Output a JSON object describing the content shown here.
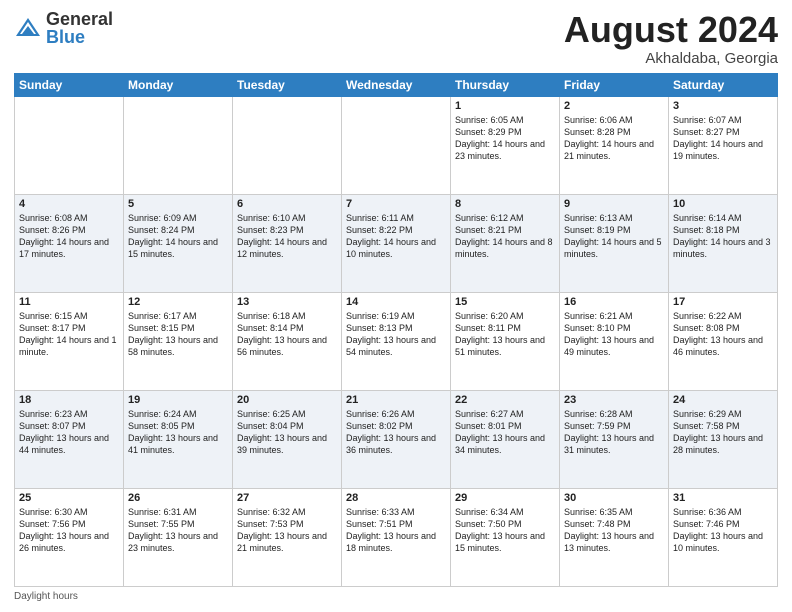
{
  "header": {
    "logo_general": "General",
    "logo_blue": "Blue",
    "month_year": "August 2024",
    "location": "Akhaldaba, Georgia"
  },
  "footer": {
    "daylight_label": "Daylight hours"
  },
  "days_of_week": [
    "Sunday",
    "Monday",
    "Tuesday",
    "Wednesday",
    "Thursday",
    "Friday",
    "Saturday"
  ],
  "weeks": [
    {
      "days": [
        {
          "num": "",
          "info": ""
        },
        {
          "num": "",
          "info": ""
        },
        {
          "num": "",
          "info": ""
        },
        {
          "num": "",
          "info": ""
        },
        {
          "num": "1",
          "info": "Sunrise: 6:05 AM\nSunset: 8:29 PM\nDaylight: 14 hours and 23 minutes."
        },
        {
          "num": "2",
          "info": "Sunrise: 6:06 AM\nSunset: 8:28 PM\nDaylight: 14 hours and 21 minutes."
        },
        {
          "num": "3",
          "info": "Sunrise: 6:07 AM\nSunset: 8:27 PM\nDaylight: 14 hours and 19 minutes."
        }
      ]
    },
    {
      "days": [
        {
          "num": "4",
          "info": "Sunrise: 6:08 AM\nSunset: 8:26 PM\nDaylight: 14 hours and 17 minutes."
        },
        {
          "num": "5",
          "info": "Sunrise: 6:09 AM\nSunset: 8:24 PM\nDaylight: 14 hours and 15 minutes."
        },
        {
          "num": "6",
          "info": "Sunrise: 6:10 AM\nSunset: 8:23 PM\nDaylight: 14 hours and 12 minutes."
        },
        {
          "num": "7",
          "info": "Sunrise: 6:11 AM\nSunset: 8:22 PM\nDaylight: 14 hours and 10 minutes."
        },
        {
          "num": "8",
          "info": "Sunrise: 6:12 AM\nSunset: 8:21 PM\nDaylight: 14 hours and 8 minutes."
        },
        {
          "num": "9",
          "info": "Sunrise: 6:13 AM\nSunset: 8:19 PM\nDaylight: 14 hours and 5 minutes."
        },
        {
          "num": "10",
          "info": "Sunrise: 6:14 AM\nSunset: 8:18 PM\nDaylight: 14 hours and 3 minutes."
        }
      ]
    },
    {
      "days": [
        {
          "num": "11",
          "info": "Sunrise: 6:15 AM\nSunset: 8:17 PM\nDaylight: 14 hours and 1 minute."
        },
        {
          "num": "12",
          "info": "Sunrise: 6:17 AM\nSunset: 8:15 PM\nDaylight: 13 hours and 58 minutes."
        },
        {
          "num": "13",
          "info": "Sunrise: 6:18 AM\nSunset: 8:14 PM\nDaylight: 13 hours and 56 minutes."
        },
        {
          "num": "14",
          "info": "Sunrise: 6:19 AM\nSunset: 8:13 PM\nDaylight: 13 hours and 54 minutes."
        },
        {
          "num": "15",
          "info": "Sunrise: 6:20 AM\nSunset: 8:11 PM\nDaylight: 13 hours and 51 minutes."
        },
        {
          "num": "16",
          "info": "Sunrise: 6:21 AM\nSunset: 8:10 PM\nDaylight: 13 hours and 49 minutes."
        },
        {
          "num": "17",
          "info": "Sunrise: 6:22 AM\nSunset: 8:08 PM\nDaylight: 13 hours and 46 minutes."
        }
      ]
    },
    {
      "days": [
        {
          "num": "18",
          "info": "Sunrise: 6:23 AM\nSunset: 8:07 PM\nDaylight: 13 hours and 44 minutes."
        },
        {
          "num": "19",
          "info": "Sunrise: 6:24 AM\nSunset: 8:05 PM\nDaylight: 13 hours and 41 minutes."
        },
        {
          "num": "20",
          "info": "Sunrise: 6:25 AM\nSunset: 8:04 PM\nDaylight: 13 hours and 39 minutes."
        },
        {
          "num": "21",
          "info": "Sunrise: 6:26 AM\nSunset: 8:02 PM\nDaylight: 13 hours and 36 minutes."
        },
        {
          "num": "22",
          "info": "Sunrise: 6:27 AM\nSunset: 8:01 PM\nDaylight: 13 hours and 34 minutes."
        },
        {
          "num": "23",
          "info": "Sunrise: 6:28 AM\nSunset: 7:59 PM\nDaylight: 13 hours and 31 minutes."
        },
        {
          "num": "24",
          "info": "Sunrise: 6:29 AM\nSunset: 7:58 PM\nDaylight: 13 hours and 28 minutes."
        }
      ]
    },
    {
      "days": [
        {
          "num": "25",
          "info": "Sunrise: 6:30 AM\nSunset: 7:56 PM\nDaylight: 13 hours and 26 minutes."
        },
        {
          "num": "26",
          "info": "Sunrise: 6:31 AM\nSunset: 7:55 PM\nDaylight: 13 hours and 23 minutes."
        },
        {
          "num": "27",
          "info": "Sunrise: 6:32 AM\nSunset: 7:53 PM\nDaylight: 13 hours and 21 minutes."
        },
        {
          "num": "28",
          "info": "Sunrise: 6:33 AM\nSunset: 7:51 PM\nDaylight: 13 hours and 18 minutes."
        },
        {
          "num": "29",
          "info": "Sunrise: 6:34 AM\nSunset: 7:50 PM\nDaylight: 13 hours and 15 minutes."
        },
        {
          "num": "30",
          "info": "Sunrise: 6:35 AM\nSunset: 7:48 PM\nDaylight: 13 hours and 13 minutes."
        },
        {
          "num": "31",
          "info": "Sunrise: 6:36 AM\nSunset: 7:46 PM\nDaylight: 13 hours and 10 minutes."
        }
      ]
    }
  ]
}
